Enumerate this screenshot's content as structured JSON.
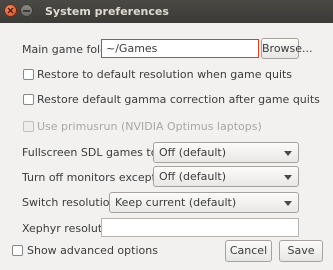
{
  "window": {
    "title": "System preferences"
  },
  "game_folder": {
    "label": "Main game folder",
    "value": "~/Games",
    "browse_label": "Browse..."
  },
  "options": {
    "restore_resolution": "Restore to default resolution when game quits",
    "restore_gamma": "Restore default gamma correction after game quits",
    "primusrun": "Use primusrun (NVIDIA Optimus laptops)"
  },
  "fullscreen_sdl": {
    "label": "Fullscreen SDL games to display",
    "value": "Off  (default)"
  },
  "turn_off_monitors": {
    "label": "Turn off monitors except",
    "value": "Off  (default)"
  },
  "switch_resolution": {
    "label": "Switch resolution to",
    "value": "Keep current  (default)"
  },
  "xephyr": {
    "label": "Xephyr resolution",
    "value": ""
  },
  "footer": {
    "show_advanced": "Show advanced options",
    "cancel_label": "Cancel",
    "save_label": "Save"
  }
}
